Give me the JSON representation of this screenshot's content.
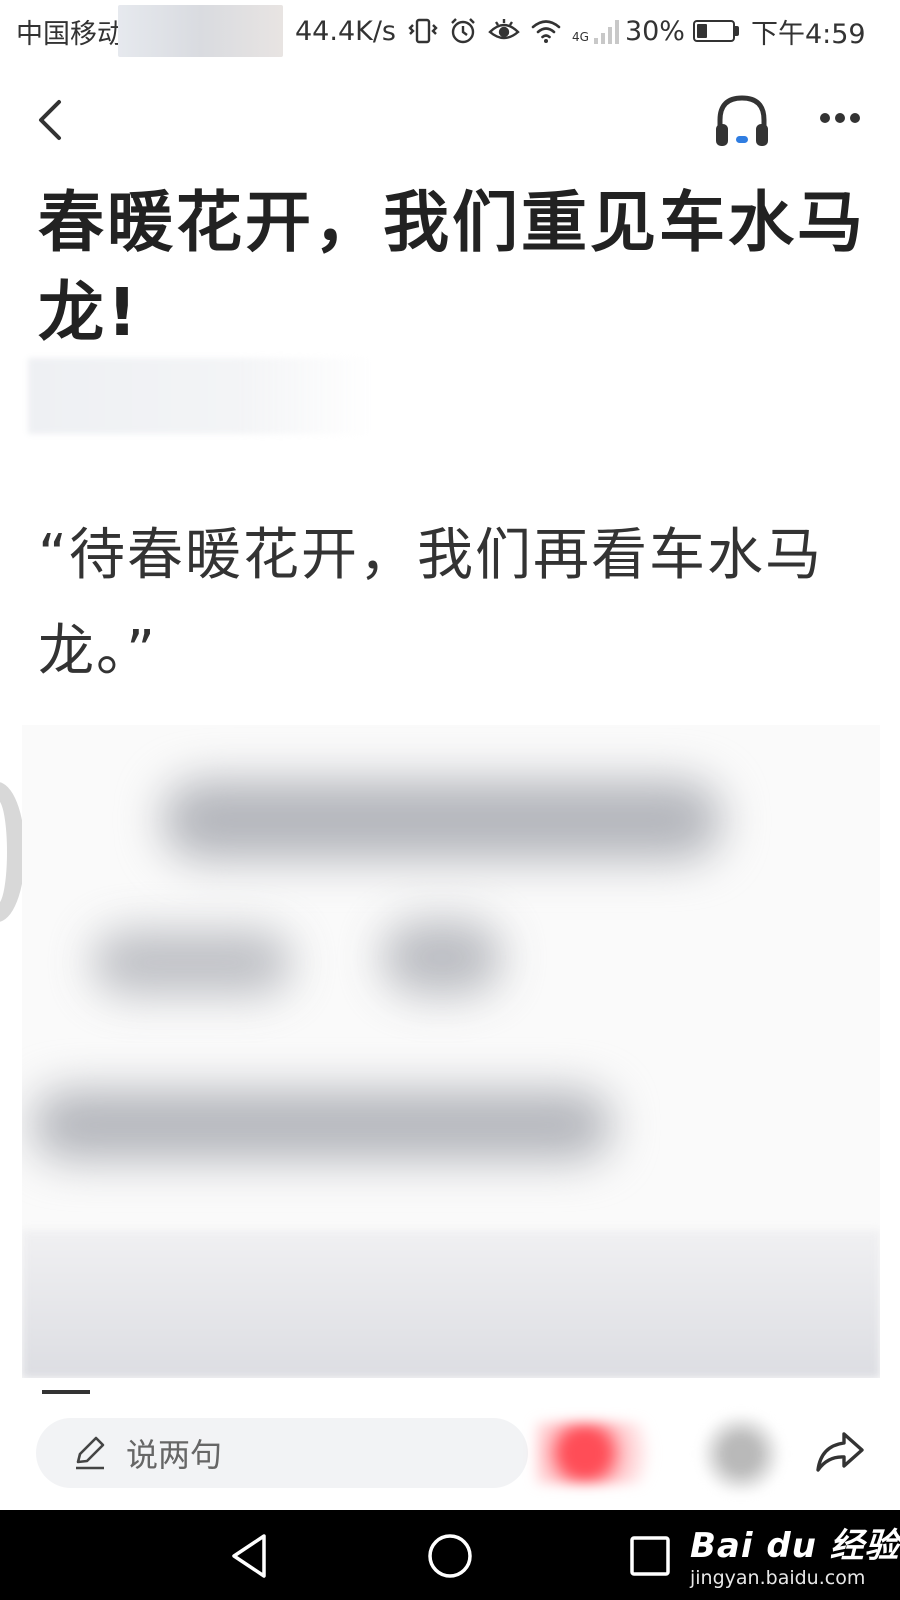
{
  "status_bar": {
    "carrier": "中国移动",
    "network_speed": "44.4K/s",
    "network_type": "4G",
    "battery_percent": "30%",
    "battery_level": 0.3,
    "time": "下午4:59",
    "icons": [
      "vibrate-icon",
      "alarm-icon",
      "eye-comfort-icon",
      "wifi-icon",
      "signal-icon",
      "battery-icon"
    ]
  },
  "nav": {
    "icons": [
      "back-icon",
      "headphones-icon",
      "more-icon"
    ],
    "accent_color": "#2f7de1"
  },
  "article": {
    "title": "春暖花开，我们重见车水马龙!",
    "quote": "“待春暖花开，我们再看车水马龙。”"
  },
  "action_bar": {
    "comment_placeholder": "说两句",
    "icons": [
      "pen-icon",
      "like-icon",
      "favorite-icon",
      "share-icon"
    ],
    "like_color": "#ff4d57"
  },
  "system_nav": {
    "icons": [
      "nav-back-icon",
      "nav-home-icon",
      "nav-recents-icon"
    ]
  },
  "watermark": {
    "logo": "Bai du 经验",
    "url": "jingyan.baidu.com"
  }
}
